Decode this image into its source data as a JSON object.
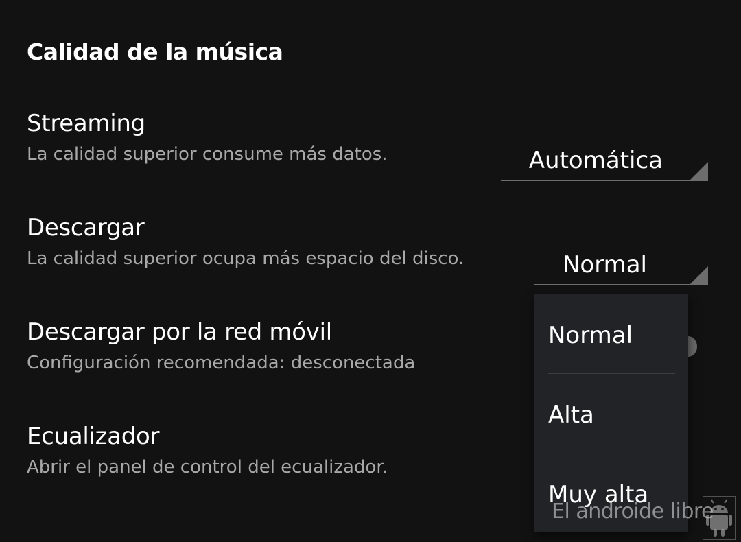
{
  "section": {
    "title": "Calidad de la música"
  },
  "settings": {
    "streaming": {
      "title": "Streaming",
      "subtitle": "La calidad superior consume más datos.",
      "value": "Automática"
    },
    "download": {
      "title": "Descargar",
      "subtitle": "La calidad superior ocupa más espacio del disco.",
      "value": "Normal"
    },
    "mobile_download": {
      "title": "Descargar por la red móvil",
      "subtitle": "Configuración recomendada: desconectada"
    },
    "equalizer": {
      "title": "Ecualizador",
      "subtitle": "Abrir el panel de control del ecualizador."
    }
  },
  "dropdown": {
    "options": [
      "Normal",
      "Alta",
      "Muy alta"
    ]
  },
  "watermark": {
    "text": "El androide libre",
    "logo_icon": "android-robot-icon"
  },
  "colors": {
    "background": "#121212",
    "menu_background": "#222326",
    "secondary_text": "#a8a8a8",
    "underline": "#6d6d6d"
  }
}
